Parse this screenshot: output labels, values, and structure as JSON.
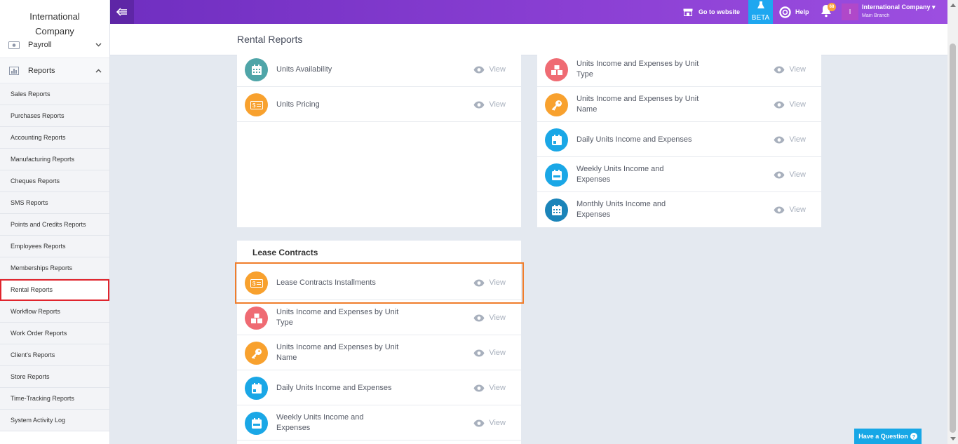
{
  "sidebar": {
    "company_line1": "International",
    "company_line2": "Company",
    "payroll_label": "Payroll",
    "reports_label": "Reports",
    "items": [
      {
        "label": "Sales Reports"
      },
      {
        "label": "Purchases Reports"
      },
      {
        "label": "Accounting Reports"
      },
      {
        "label": "Manufacturing Reports"
      },
      {
        "label": "Cheques Reports"
      },
      {
        "label": "SMS Reports"
      },
      {
        "label": "Points and Credits Reports"
      },
      {
        "label": "Employees Reports"
      },
      {
        "label": "Memberships Reports"
      },
      {
        "label": "Rental Reports",
        "highlighted": true
      },
      {
        "label": "Workflow Reports"
      },
      {
        "label": "Work Order Reports"
      },
      {
        "label": "Client's Reports"
      },
      {
        "label": "Store Reports"
      },
      {
        "label": "Time-Tracking Reports"
      },
      {
        "label": "System Activity Log"
      }
    ]
  },
  "topbar": {
    "go_to_website": "Go to website",
    "beta": "BETA",
    "help": "Help",
    "notifications_count": "68",
    "avatar_initial": "I",
    "company_name": "International Company",
    "branch": "Main Branch"
  },
  "page": {
    "title": "Rental Reports"
  },
  "view_label": "View",
  "colors": {
    "teal": "#4fa5a8",
    "orange": "#f8a12e",
    "red": "#ef6b73",
    "blue": "#1aa7e6",
    "darkblue": "#1b84b9",
    "highlight": "#f07d2b",
    "sidebar_highlight": "#e0242d"
  },
  "panel_left_top": {
    "rows": [
      {
        "label": "Units Availability",
        "icon": "calendar-grid-icon",
        "color": "teal"
      },
      {
        "label": "Units Pricing",
        "icon": "money-icon",
        "color": "orange"
      }
    ]
  },
  "panel_right_top": {
    "rows": [
      {
        "label": "Units Income and Expenses by Unit Type",
        "icon": "boxes-icon",
        "color": "red"
      },
      {
        "label": "Units Income and Expenses by Unit Name",
        "icon": "key-icon",
        "color": "orange"
      },
      {
        "label": "Daily Units Income and Expenses",
        "icon": "calendar-day-icon",
        "color": "blue"
      },
      {
        "label": "Weekly Units Income and Expenses",
        "icon": "calendar-week-icon",
        "color": "blue"
      },
      {
        "label": "Monthly Units Income and Expenses",
        "icon": "calendar-month-icon",
        "color": "darkblue"
      }
    ]
  },
  "lease_contracts": {
    "title": "Lease Contracts",
    "rows": [
      {
        "label": "Lease Contracts Installments",
        "icon": "money-icon",
        "color": "orange"
      },
      {
        "label": "Units Income and Expenses by Unit Type",
        "icon": "boxes-icon",
        "color": "red"
      },
      {
        "label": "Units Income and Expenses by Unit Name",
        "icon": "key-icon",
        "color": "orange"
      },
      {
        "label": "Daily Units Income and Expenses",
        "icon": "calendar-day-icon",
        "color": "blue"
      },
      {
        "label": "Weekly Units Income and Expenses",
        "icon": "calendar-week-icon",
        "color": "blue"
      }
    ]
  },
  "have_question": "Have a Question"
}
